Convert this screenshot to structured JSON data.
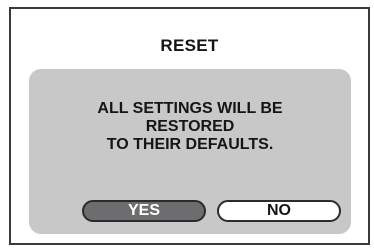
{
  "dialog": {
    "title": "RESET",
    "message_lines": [
      "ALL SETTINGS WILL BE",
      "RESTORED",
      "TO THEIR DEFAULTS."
    ],
    "buttons": {
      "yes_label": "YES",
      "no_label": "NO",
      "selected": "YES"
    }
  },
  "colors": {
    "frame_border": "#3a3a3a",
    "dialog_background": "#c8c8c9",
    "selected_button": "#6d6d70",
    "unselected_button": "#ffffff",
    "text": "#151515"
  }
}
